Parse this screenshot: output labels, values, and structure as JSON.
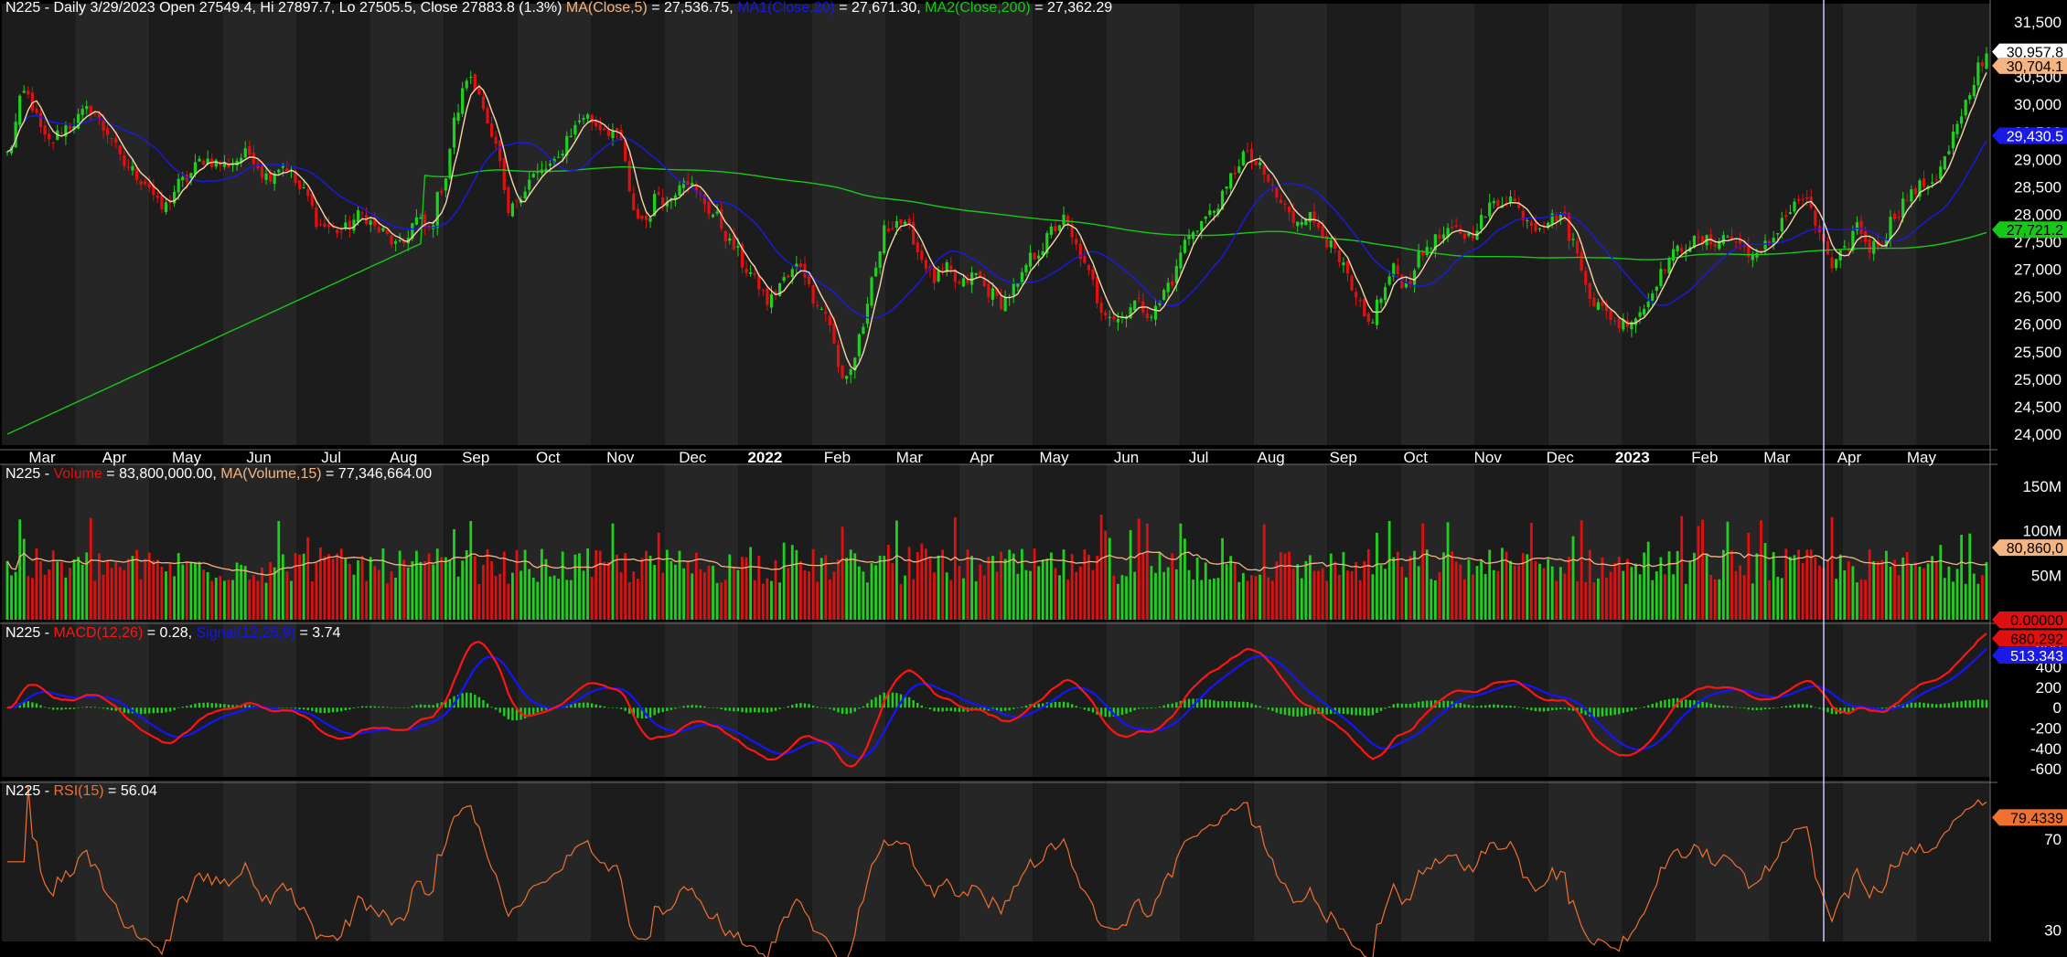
{
  "colors": {
    "background": "#000000",
    "panel": "#1c1c1c",
    "grid_band": "#262626",
    "separator": "#6b6b6b",
    "up": "#1fd01f",
    "down": "#e01010",
    "ma5": "#f7d7a8",
    "ma20": "#1a1ae6",
    "ma200": "#18c818",
    "volume_ma": "#f4b582",
    "macd": "#ff1414",
    "signal": "#1414ff",
    "rsi": "#f07030",
    "cursor": "#c8c8ff"
  },
  "header": {
    "price": {
      "prefix": "N225 - Daily 3/29/2023 Open 27549.4, Hi 27897.7, Lo 27505.5, Close 27883.8 (1.3%) ",
      "ma_label": "MA(Close,5)",
      "ma_value": " = 27,536.75, ",
      "ma1_label": "MA1(Close,20)",
      "ma1_value": " = 27,671.30, ",
      "ma2_label": "MA2(Close,200)",
      "ma2_value": " = 27,362.29"
    },
    "volume": {
      "prefix": "N225 - ",
      "label": "Volume",
      "value": " = 83,800,000.00, ",
      "ma_label": "MA(Volume,15)",
      "ma_value": " = 77,346,664.00"
    },
    "macd": {
      "prefix": "N225 - ",
      "label": "MACD(12,26)",
      "value": " = 0.28, ",
      "signal_label": "Signal(12,26,9)",
      "signal_value": " = 3.74"
    },
    "rsi": {
      "prefix": "N225 - ",
      "label": "RSI(15)",
      "value": " = 56.04"
    }
  },
  "right_axis": {
    "price_ticks": [
      "31,500",
      "31,000",
      "30,500",
      "30,000",
      "29,500",
      "29,000",
      "28,500",
      "28,000",
      "27,500",
      "27,000",
      "26,500",
      "26,000",
      "25,500",
      "25,000",
      "24,500",
      "24,000"
    ],
    "price_badges": [
      {
        "text": "30,957.8",
        "value": 30957.8,
        "bg": "#ffffff",
        "fg": "#000000"
      },
      {
        "text": "30,704.1",
        "value": 30704.1,
        "bg": "#f4b582",
        "fg": "#000000"
      },
      {
        "text": "29,430.5",
        "value": 29430.5,
        "bg": "#1a1ae6",
        "fg": "#ffffff"
      },
      {
        "text": "27,721.2",
        "value": 27721.2,
        "bg": "#18c818",
        "fg": "#000000"
      }
    ],
    "volume_ticks": [
      "150M",
      "100M",
      "50M"
    ],
    "volume_badges": [
      {
        "text": "80,860,0",
        "value": 80.86,
        "bg": "#f4b582",
        "fg": "#000000"
      },
      {
        "text": "0.00000",
        "value": 0,
        "bg": "#e01010",
        "fg": "#000000"
      }
    ],
    "macd_ticks": [
      "600",
      "400",
      "200",
      "0",
      "-200",
      "-400",
      "-600"
    ],
    "macd_badges": [
      {
        "text": "680.292",
        "value": 680.292,
        "bg": "#e01010",
        "fg": "#000000"
      },
      {
        "text": "513.343",
        "value": 513.343,
        "bg": "#1a1ae6",
        "fg": "#ffffff"
      }
    ],
    "rsi_ticks": [
      "70",
      "30"
    ],
    "rsi_badges": [
      {
        "text": "79.4339",
        "value": 79.4339,
        "bg": "#f07030",
        "fg": "#000000"
      }
    ]
  },
  "chart_data": {
    "type": "candlestick",
    "symbol": "N225",
    "interval": "Daily",
    "x_labels": [
      {
        "text": "Mar",
        "bold": false
      },
      {
        "text": "Apr",
        "bold": false
      },
      {
        "text": "May",
        "bold": false
      },
      {
        "text": "Jun",
        "bold": false
      },
      {
        "text": "Jul",
        "bold": false
      },
      {
        "text": "Aug",
        "bold": false
      },
      {
        "text": "Sep",
        "bold": false
      },
      {
        "text": "Oct",
        "bold": false
      },
      {
        "text": "Nov",
        "bold": false
      },
      {
        "text": "Dec",
        "bold": false
      },
      {
        "text": "2022",
        "bold": true
      },
      {
        "text": "Feb",
        "bold": false
      },
      {
        "text": "Mar",
        "bold": false
      },
      {
        "text": "Apr",
        "bold": false
      },
      {
        "text": "May",
        "bold": false
      },
      {
        "text": "Jun",
        "bold": false
      },
      {
        "text": "Jul",
        "bold": false
      },
      {
        "text": "Aug",
        "bold": false
      },
      {
        "text": "Sep",
        "bold": false
      },
      {
        "text": "Oct",
        "bold": false
      },
      {
        "text": "Nov",
        "bold": false
      },
      {
        "text": "Dec",
        "bold": false
      },
      {
        "text": "2023",
        "bold": true
      },
      {
        "text": "Feb",
        "bold": false
      },
      {
        "text": "Mar",
        "bold": false
      },
      {
        "text": "Apr",
        "bold": false
      },
      {
        "text": "May",
        "bold": false
      }
    ],
    "price_range": [
      23800,
      31600
    ],
    "volume_range": [
      0,
      160
    ],
    "macd_range": [
      -680,
      720
    ],
    "rsi_range": [
      25,
      90
    ],
    "close_anchors": [
      [
        0,
        29100
      ],
      [
        4,
        30200
      ],
      [
        10,
        29300
      ],
      [
        14,
        29600
      ],
      [
        20,
        29900
      ],
      [
        24,
        29500
      ],
      [
        28,
        28900
      ],
      [
        33,
        28600
      ],
      [
        37,
        28100
      ],
      [
        42,
        28600
      ],
      [
        47,
        29000
      ],
      [
        52,
        28900
      ],
      [
        58,
        29100
      ],
      [
        62,
        28700
      ],
      [
        66,
        28900
      ],
      [
        71,
        28400
      ],
      [
        75,
        27800
      ],
      [
        80,
        27700
      ],
      [
        85,
        28000
      ],
      [
        89,
        27700
      ],
      [
        94,
        27400
      ],
      [
        98,
        27900
      ],
      [
        101,
        27700
      ],
      [
        104,
        28500
      ],
      [
        108,
        29900
      ],
      [
        110,
        30500
      ],
      [
        113,
        30200
      ],
      [
        117,
        29200
      ],
      [
        120,
        28000
      ],
      [
        123,
        28400
      ],
      [
        126,
        28700
      ],
      [
        131,
        28900
      ],
      [
        135,
        29500
      ],
      [
        138,
        29800
      ],
      [
        142,
        29600
      ],
      [
        145,
        29500
      ],
      [
        147,
        29300
      ],
      [
        150,
        28000
      ],
      [
        153,
        27900
      ],
      [
        156,
        28400
      ],
      [
        158,
        28200
      ],
      [
        162,
        28700
      ],
      [
        166,
        28300
      ],
      [
        169,
        28000
      ],
      [
        174,
        27400
      ],
      [
        177,
        27000
      ],
      [
        180,
        26700
      ],
      [
        182,
        26400
      ],
      [
        186,
        26800
      ],
      [
        190,
        27100
      ],
      [
        193,
        26500
      ],
      [
        196,
        26200
      ],
      [
        200,
        25000
      ],
      [
        202,
        25200
      ],
      [
        205,
        26000
      ],
      [
        208,
        27000
      ],
      [
        210,
        27700
      ],
      [
        213,
        27900
      ],
      [
        216,
        27700
      ],
      [
        219,
        27200
      ],
      [
        222,
        26800
      ],
      [
        225,
        27000
      ],
      [
        228,
        26700
      ],
      [
        232,
        26900
      ],
      [
        235,
        26600
      ],
      [
        238,
        26400
      ],
      [
        242,
        26700
      ],
      [
        245,
        27200
      ],
      [
        248,
        27400
      ],
      [
        250,
        27700
      ],
      [
        253,
        27900
      ],
      [
        256,
        27400
      ],
      [
        259,
        26900
      ],
      [
        262,
        26300
      ],
      [
        266,
        26100
      ],
      [
        270,
        26400
      ],
      [
        274,
        26200
      ],
      [
        279,
        26800
      ],
      [
        282,
        27500
      ],
      [
        285,
        27800
      ],
      [
        288,
        28000
      ],
      [
        291,
        28300
      ],
      [
        294,
        28800
      ],
      [
        296,
        29100
      ],
      [
        299,
        28900
      ],
      [
        302,
        28600
      ],
      [
        305,
        28200
      ],
      [
        308,
        27900
      ],
      [
        311,
        28000
      ],
      [
        314,
        27800
      ],
      [
        317,
        27400
      ],
      [
        320,
        27000
      ],
      [
        323,
        26400
      ],
      [
        326,
        26000
      ],
      [
        329,
        26500
      ],
      [
        332,
        27000
      ],
      [
        335,
        26700
      ],
      [
        338,
        27200
      ],
      [
        341,
        27500
      ],
      [
        344,
        27600
      ],
      [
        347,
        27700
      ],
      [
        350,
        27600
      ],
      [
        353,
        27900
      ],
      [
        356,
        28200
      ],
      [
        360,
        28300
      ],
      [
        363,
        28000
      ],
      [
        366,
        27800
      ],
      [
        369,
        27900
      ],
      [
        372,
        28000
      ],
      [
        375,
        27500
      ],
      [
        377,
        27000
      ],
      [
        380,
        26400
      ],
      [
        383,
        26200
      ],
      [
        386,
        26000
      ],
      [
        389,
        26100
      ],
      [
        392,
        26300
      ],
      [
        395,
        26800
      ],
      [
        398,
        27200
      ],
      [
        401,
        27400
      ],
      [
        404,
        27500
      ],
      [
        408,
        27500
      ],
      [
        412,
        27600
      ],
      [
        416,
        27400
      ],
      [
        419,
        27200
      ],
      [
        422,
        27500
      ],
      [
        426,
        28000
      ],
      [
        430,
        28300
      ],
      [
        434,
        27700
      ],
      [
        437,
        27000
      ],
      [
        440,
        27300
      ],
      [
        443,
        27800
      ],
      [
        446,
        27400
      ],
      [
        449,
        27500
      ],
      [
        452,
        28000
      ],
      [
        455,
        28300
      ],
      [
        458,
        28500
      ],
      [
        461,
        28600
      ],
      [
        464,
        29000
      ],
      [
        467,
        29600
      ],
      [
        470,
        30100
      ],
      [
        472,
        30700
      ],
      [
        474,
        30900
      ]
    ],
    "rsi_last": 79.43
  }
}
